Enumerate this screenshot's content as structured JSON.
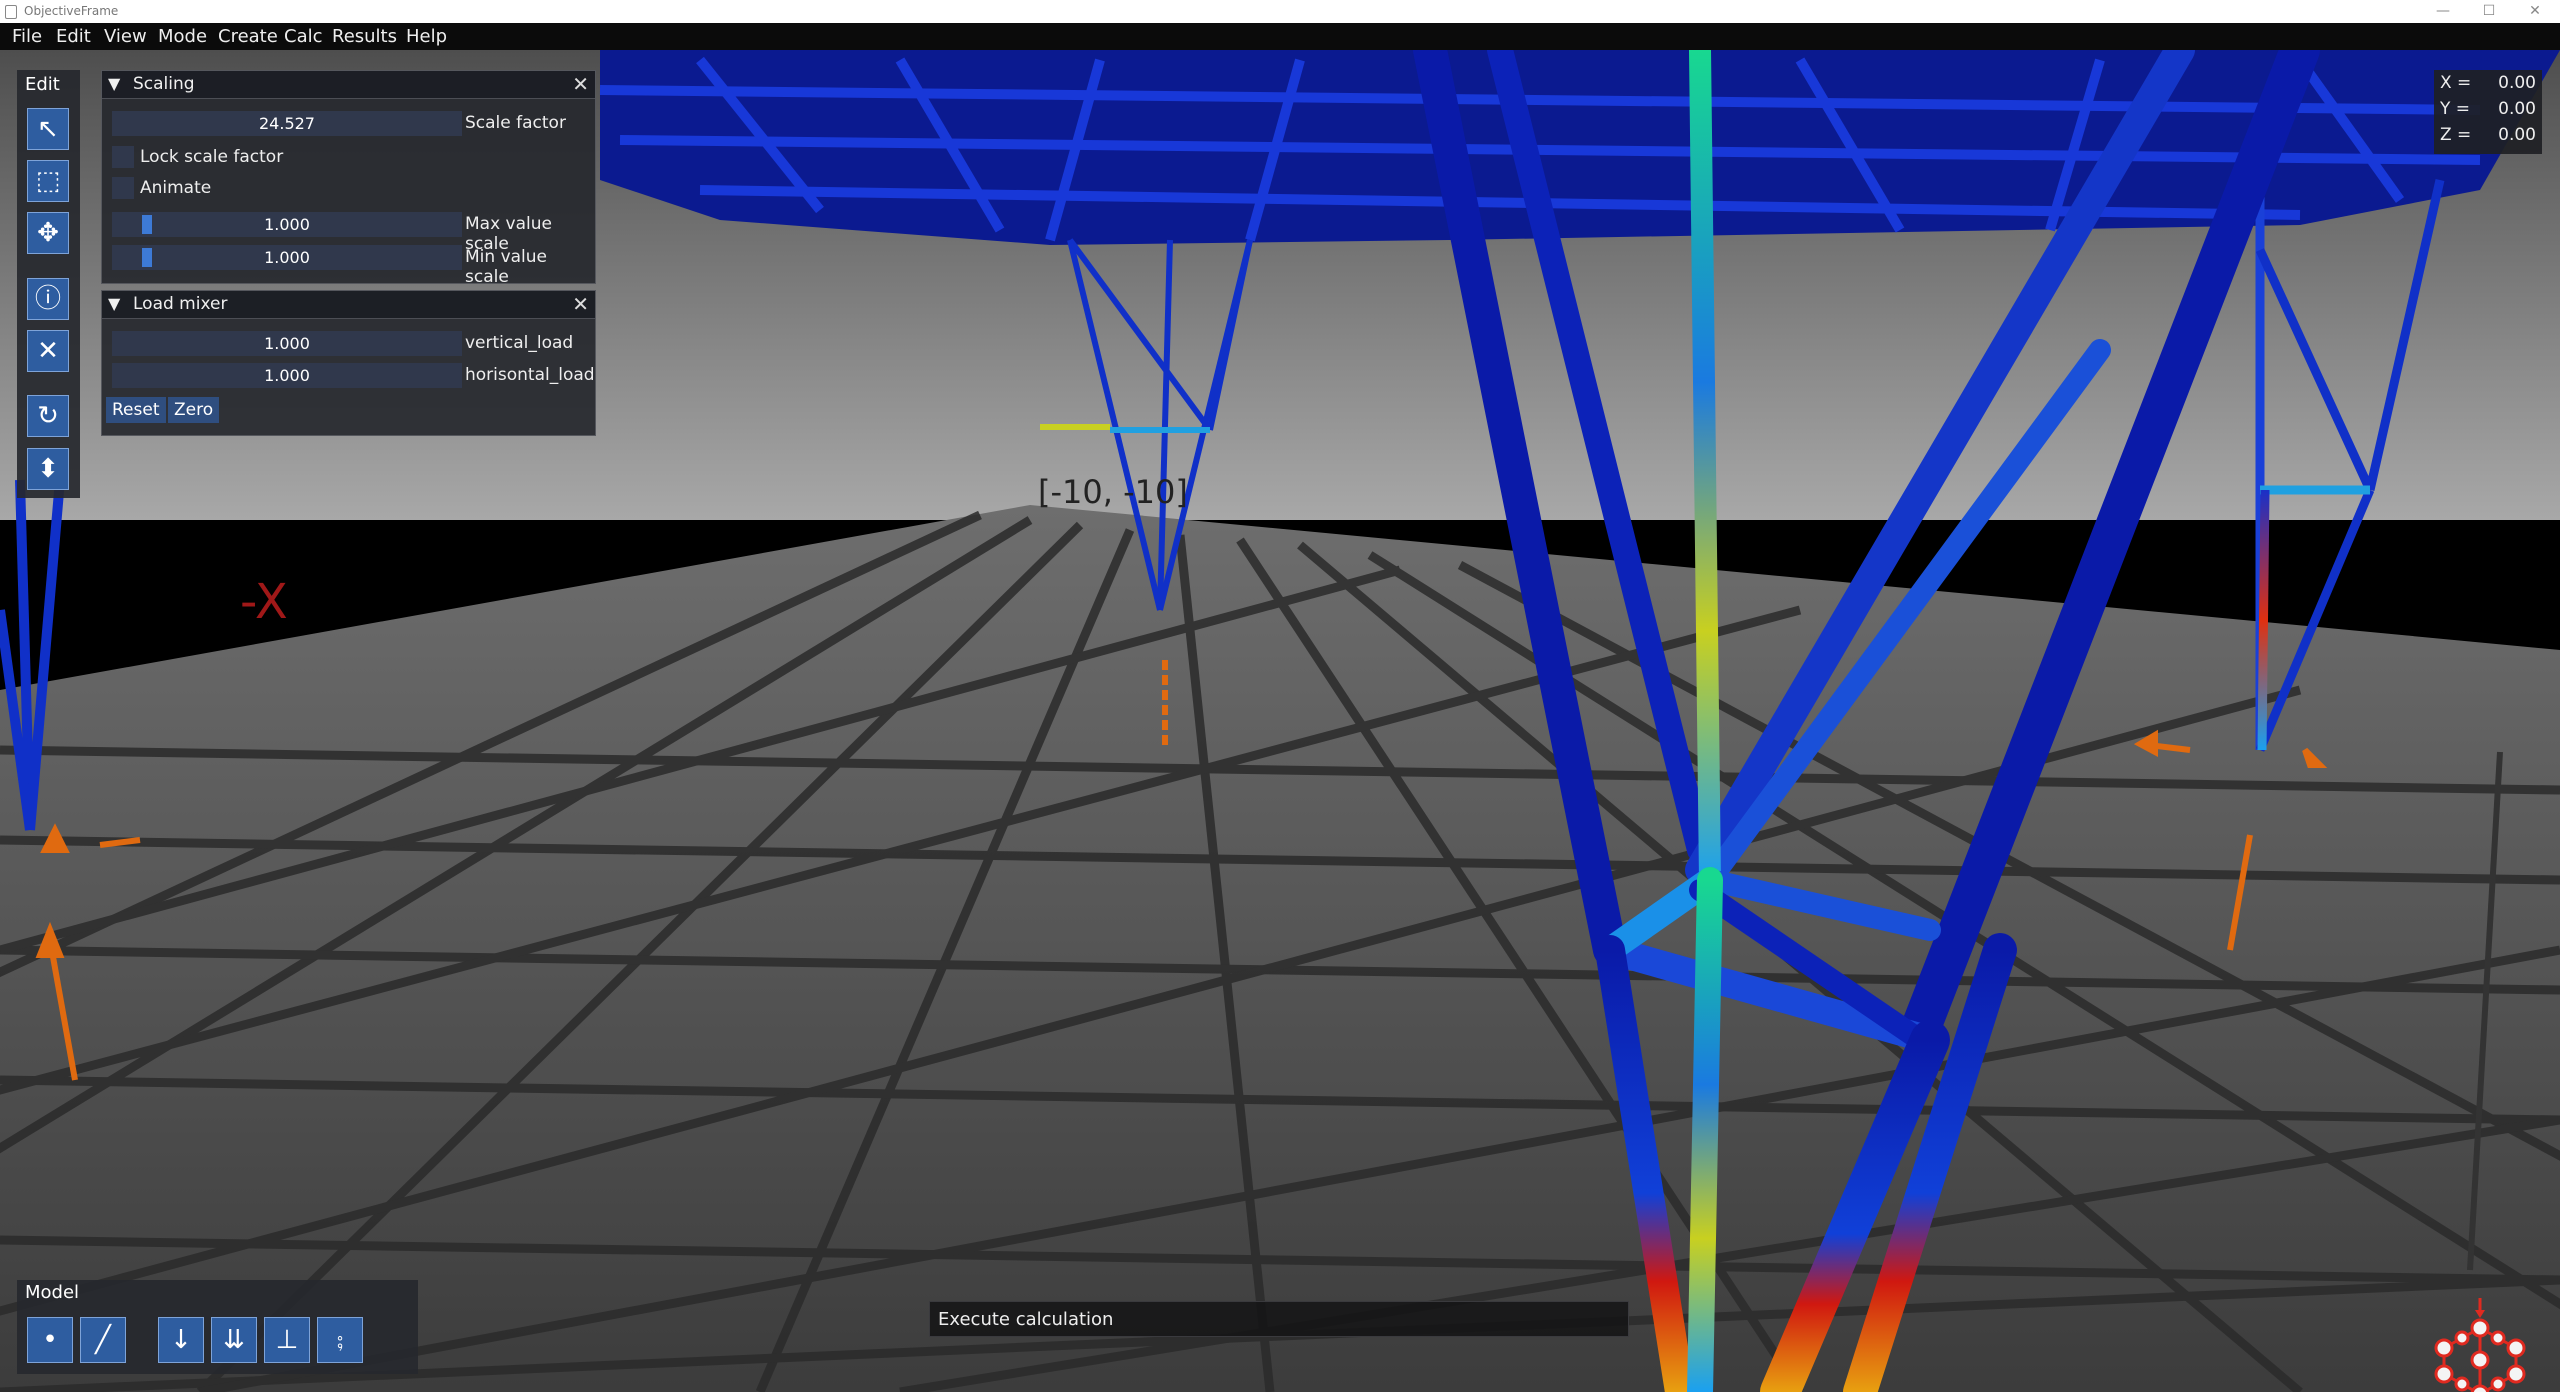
{
  "window": {
    "title": "ObjectiveFrame",
    "minimize": "—",
    "maximize": "☐",
    "close": "✕"
  },
  "menu": [
    "File",
    "Edit",
    "View",
    "Mode",
    "Create",
    "Calc",
    "Results",
    "Help"
  ],
  "viewport": {
    "axis_label": "-X",
    "grid_label": "[-10, -10]",
    "colors": {
      "sky_top": "#585858",
      "sky_horizon": "#a6a6a6",
      "ground": "#4a4a4a",
      "grid": "#2a2a2a",
      "beam_low": "#0a1aa8",
      "beam_high": "#e02a10",
      "load_arrow": "#e06a10"
    }
  },
  "edit_toolbox": {
    "label": "Edit",
    "tools": [
      "select-icon",
      "box-select-icon",
      "move-icon",
      "inspect-icon",
      "clear-icon",
      "rotate-icon",
      "transform-icon"
    ]
  },
  "scaling_panel": {
    "title": "Scaling",
    "scale_factor": {
      "value": "24.527",
      "label": "Scale factor"
    },
    "lock_scale_factor": {
      "label": "Lock scale factor",
      "checked": false
    },
    "animate": {
      "label": "Animate",
      "checked": false
    },
    "max_value_scale": {
      "value": "1.000",
      "label": "Max value scale"
    },
    "min_value_scale": {
      "value": "1.000",
      "label": "Min value scale"
    }
  },
  "load_mixer_panel": {
    "title": "Load mixer",
    "vertical_load": {
      "value": "1.000",
      "label": "vertical_load"
    },
    "horisontal_load": {
      "value": "1.000",
      "label": "horisontal_load"
    },
    "reset_label": "Reset",
    "zero_label": "Zero"
  },
  "model_toolbar": {
    "label": "Model",
    "tools": [
      "node-icon",
      "beam-icon",
      "node-load-icon",
      "beam-load-icon",
      "node-bc-icon",
      "beam-bc-icon"
    ]
  },
  "console": {
    "text": "Execute calculation"
  },
  "coordinates": {
    "x_label": "X =",
    "x_value": "0.00",
    "y_label": "Y =",
    "y_value": "0.00",
    "z_label": "Z =",
    "z_value": "0.00"
  }
}
